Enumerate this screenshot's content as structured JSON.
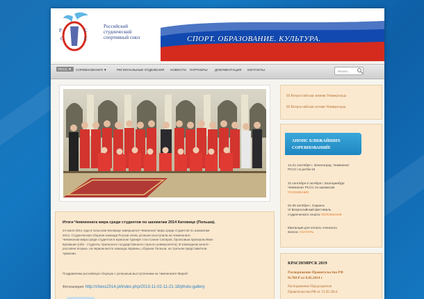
{
  "header": {
    "org_name_lines": [
      "Российский",
      "студенческий",
      "спортивный союз"
    ],
    "logo_letters": [
      "Р",
      "С",
      "С",
      "С"
    ],
    "slogan": "СПОРТ.  ОБРАЗОВАНИЕ.  КУЛЬТУРА."
  },
  "nav": {
    "items": [
      "РССС ▼",
      "СОРЕВНОВАНИЯ ▼",
      "РЕГИОНАЛЬНЫЕ ОТДЕЛЕНИЯ",
      "НОВОСТИ",
      "ПАРТНЕРЫ",
      "ДОКУМЕНТАЦИЯ",
      "КОНТАКТЫ"
    ],
    "search_placeholder": "Искать..."
  },
  "news": {
    "title": "Итоги Чемпионата мира среди студентов по шахматам 2014 Катовице (Польша).",
    "text_lines": [
      "24 июля 2014 года в польском Катовице завершился Чемпионат мира среди студентов по шахматам",
      "2014. Студенческая сборная команда России очень успешно выступила на чемпионате.",
      "Чемпионом мира среди студентов в мужском турнире стал Санан Сюгиров, бронзовым призером Иван",
      "Букавшин (оба - студенты Уральского государственного горного университета). В командном зачете -",
      "россияне вторые, на первом месте команда Украины, сборная Польши, на третьем представители",
      "Армении."
    ],
    "end_text": "Поздравляем российскую сборную с успешным выступлением на Чемпионате Мира!!!",
    "gallery_label": "Фотогалерея:",
    "gallery_link": "http://chess2014.pl/index.php/2013-11-02-11-21-18/photo-gallery"
  },
  "sidebar": {
    "top_links": [
      "III Всероссийская зимняя Универсиада",
      "III Всероссийская летняя Универсиада"
    ],
    "announce_title": [
      "АНОНС БЛИЖАЙШИХ",
      "СОРЕВНОВАНИЙ!"
    ],
    "events": [
      {
        "lines": [
          "14-21 сентября г. Зеленоград.  Чемпионат",
          "РССС по регби-15"
        ],
        "link": ""
      },
      {
        "lines": [
          "22 сентября-2 октября  г. Екатеринбург",
          "Чемпионат РССС  по шахматам"
        ],
        "link": "ПОЛОЖЕНИЕ"
      },
      {
        "lines": [
          "01-06 октября г. Саранск",
          "VI Всероссийский фестиваль",
          "студенческого спорта"
        ],
        "link": "ПОЛОЖЕНИЕ"
      },
      {
        "lines": [
          "Квитанция для оплаты членского",
          "взноса:"
        ],
        "link": "СКАЧАТЬ"
      }
    ],
    "krasn_title": "КРАСНОЯРСК 2019",
    "krasn_links": [
      "Распоряжение Правительства РФ",
      "№768-Р от 8.05.2014 г",
      "Распоряжение Председателя",
      "Правительства РФ от 15.02.2014"
    ]
  },
  "colors": {
    "accent_blue": "#1e86c1",
    "link_orange": "#e07b2b",
    "panel_bg": "#fbe9cf",
    "flag_red": "#d52b1e",
    "flag_blue": "#0d3e9a"
  }
}
